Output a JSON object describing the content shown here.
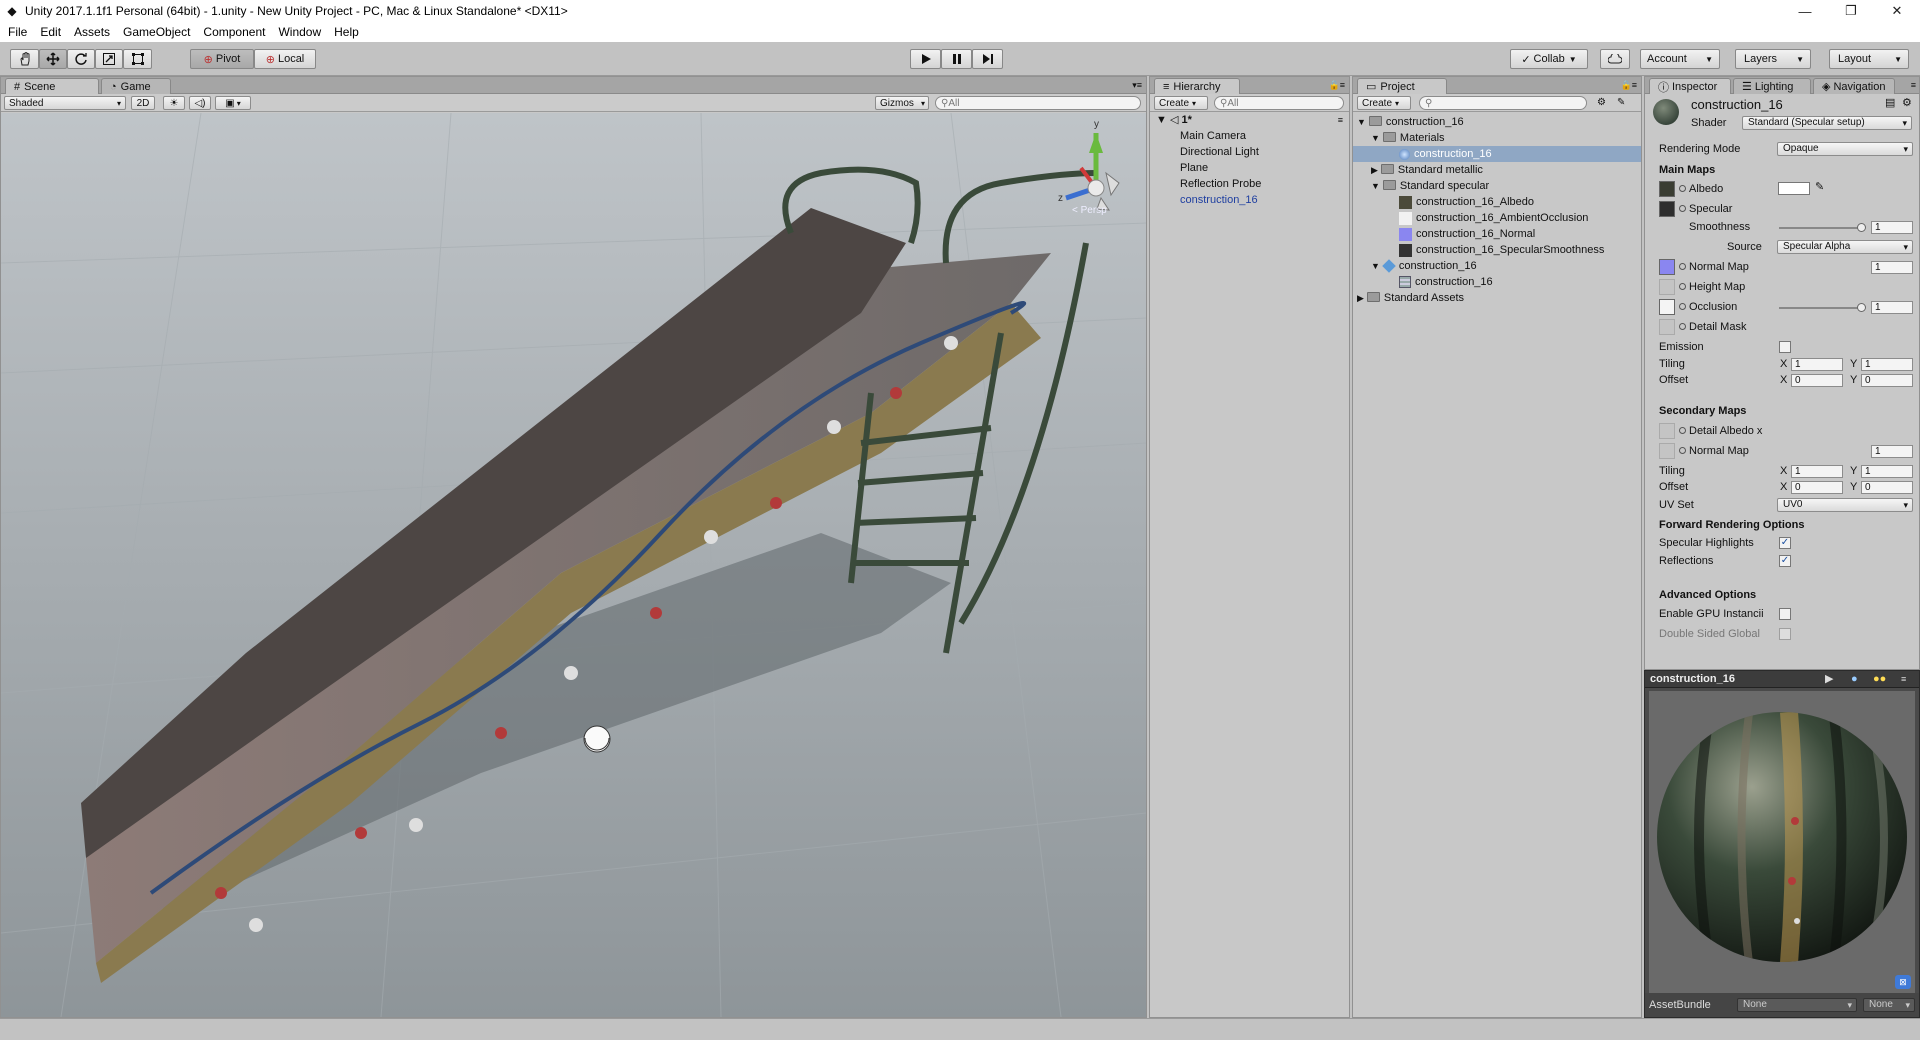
{
  "window": {
    "title": "Unity 2017.1.1f1 Personal (64bit) - 1.unity - New Unity Project - PC, Mac & Linux Standalone* <DX11>",
    "minimize": "—",
    "maximize": "❐",
    "close": "✕"
  },
  "menu": [
    "File",
    "Edit",
    "Assets",
    "GameObject",
    "Component",
    "Window",
    "Help"
  ],
  "toolbar": {
    "tools": [
      "hand-icon",
      "move-icon",
      "rotate-icon",
      "scale-icon",
      "rect-icon"
    ],
    "pivot": "Pivot",
    "local": "Local",
    "collab": "Collab",
    "account": "Account",
    "layers": "Layers",
    "layout": "Layout"
  },
  "scene": {
    "tabs": [
      "Scene",
      "Game"
    ],
    "shading": "Shaded",
    "mode2d": "2D",
    "gizmos": "Gizmos",
    "search_placeholder": "All",
    "persp": "< Persp",
    "axis_y": "y",
    "axis_z": "z"
  },
  "hierarchy": {
    "tab": "Hierarchy",
    "create": "Create",
    "search_placeholder": "All",
    "scene_name": "1*",
    "items": [
      "Main Camera",
      "Directional Light",
      "Plane",
      "Reflection Probe",
      "construction_16"
    ]
  },
  "project": {
    "tab": "Project",
    "create": "Create",
    "tree": [
      "construction_16",
      "Materials",
      "construction_16",
      "Standard metallic",
      "Standard specular",
      "construction_16_Albedo",
      "construction_16_AmbientOcclusion",
      "construction_16_Normal",
      "construction_16_SpecularSmoothness",
      "construction_16",
      "construction_16",
      "Standard Assets"
    ]
  },
  "inspector": {
    "tabs": [
      "Inspector",
      "Lighting",
      "Navigation"
    ],
    "material_name": "construction_16",
    "shader_label": "Shader",
    "shader_value": "Standard (Specular setup)",
    "rendering_mode_label": "Rendering Mode",
    "rendering_mode_value": "Opaque",
    "main_maps": "Main Maps",
    "albedo": "Albedo",
    "specular": "Specular",
    "smoothness": "Smoothness",
    "smoothness_value": "1",
    "source": "Source",
    "source_value": "Specular Alpha",
    "normal_map": "Normal Map",
    "normal_map_value": "1",
    "height_map": "Height Map",
    "occlusion": "Occlusion",
    "occlusion_value": "1",
    "detail_mask": "Detail Mask",
    "emission": "Emission",
    "tiling": "Tiling",
    "offset": "Offset",
    "tiling_x": "1",
    "tiling_y": "1",
    "offset_x": "0",
    "offset_y": "0",
    "x": "X",
    "y": "Y",
    "secondary_maps": "Secondary Maps",
    "detail_albedo": "Detail Albedo x",
    "sec_normal_map": "Normal Map",
    "sec_normal_value": "1",
    "sec_tiling_x": "1",
    "sec_tiling_y": "1",
    "sec_offset_x": "0",
    "sec_offset_y": "0",
    "uv_set": "UV Set",
    "uv_set_value": "UV0",
    "forward_options": "Forward Rendering Options",
    "specular_highlights": "Specular Highlights",
    "reflections": "Reflections",
    "advanced_options": "Advanced Options",
    "gpu_instancing": "Enable GPU Instancii",
    "double_sided": "Double Sided Global",
    "preview_title": "construction_16",
    "asset_bundle": "AssetBundle",
    "bundle_value": "None",
    "variant_value": "None",
    "check": "✓"
  }
}
